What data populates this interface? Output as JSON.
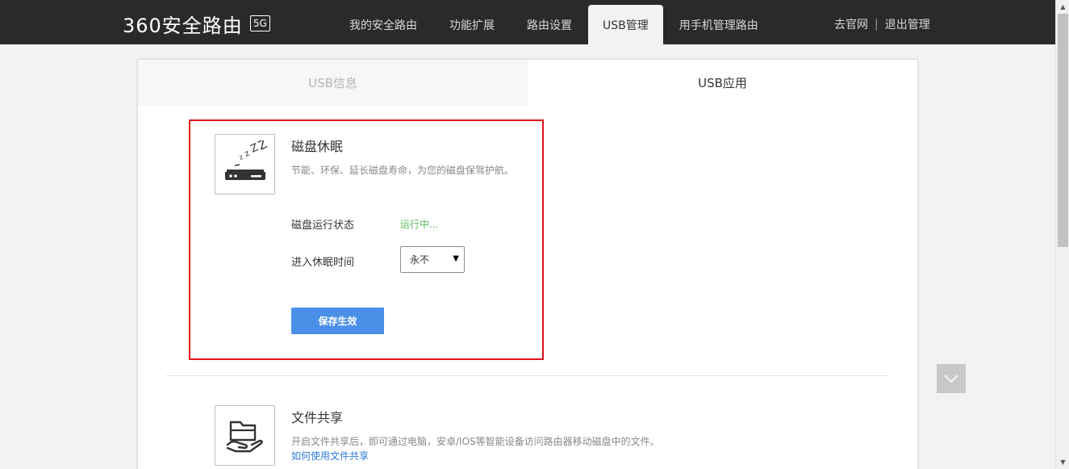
{
  "brand": {
    "name": "360安全路由",
    "badge": "5G"
  },
  "nav": {
    "items": [
      {
        "label": "我的安全路由"
      },
      {
        "label": "功能扩展"
      },
      {
        "label": "路由设置"
      },
      {
        "label": "USB管理",
        "active": true
      },
      {
        "label": "用手机管理路由"
      }
    ]
  },
  "top_links": {
    "official_site": "去官网",
    "separator": "|",
    "logout": "退出管理"
  },
  "tabs": [
    {
      "label": "USB信息",
      "active": false
    },
    {
      "label": "USB应用",
      "active": true
    }
  ],
  "disk_sleep": {
    "icon": "disk-sleep-icon",
    "title": "磁盘休眠",
    "description": "节能、环保、延长磁盘寿命，为您的磁盘保驾护航。",
    "status_label": "磁盘运行状态",
    "status_value": "运行中...",
    "sleep_time_label": "进入休眠时间",
    "sleep_time_value": "永不",
    "save_button": "保存生效"
  },
  "file_share": {
    "icon": "file-share-icon",
    "title": "文件共享",
    "description": "开启文件共享后，即可通过电脑，安卓/IOS等智能设备访问路由器移动磁盘中的文件。",
    "help_link": "如何使用文件共享"
  },
  "colors": {
    "topbar": "#2a2a2a",
    "accent_button": "#4a90e8",
    "status_running": "#5cb85c",
    "link": "#2e7bd9",
    "highlight_border": "#e0121b"
  }
}
